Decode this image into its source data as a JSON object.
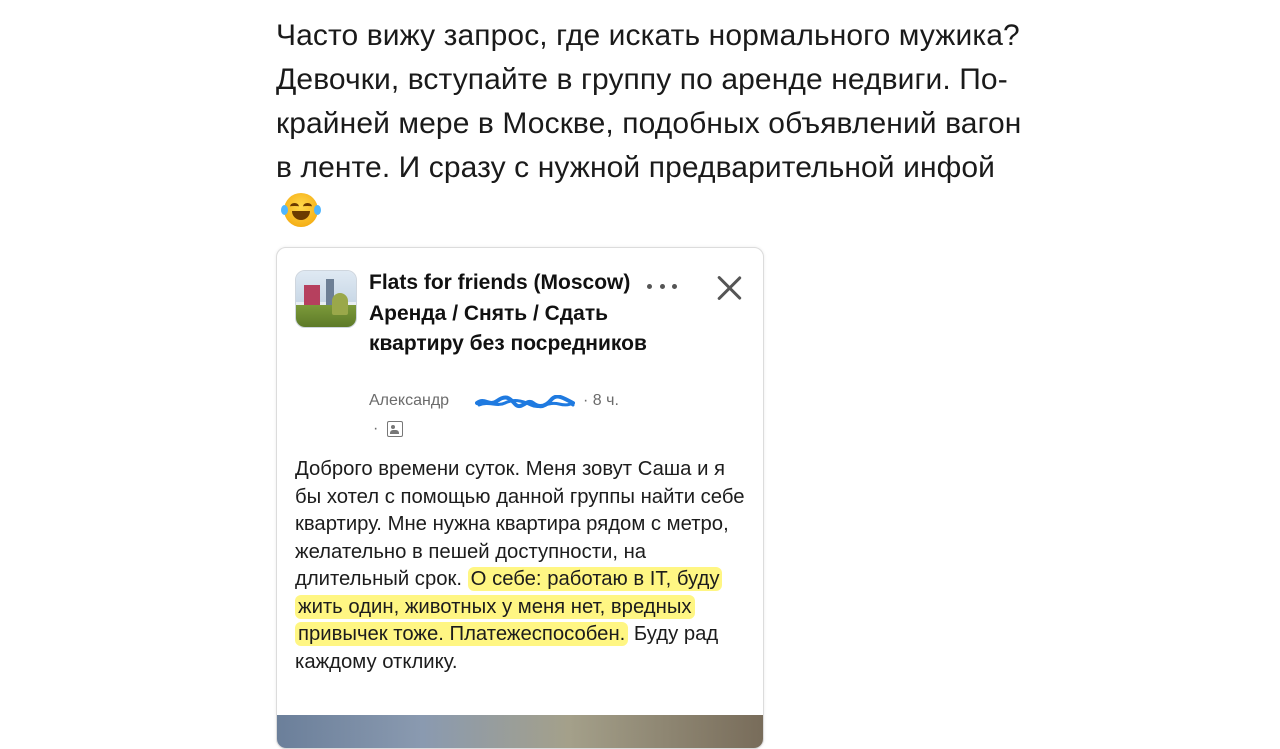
{
  "caption": {
    "text": "Часто вижу запрос, где искать нормального мужика? Девочки, вступайте в группу по аренде недвиги. По-крайней мере в Москве, подобных объявлений вагон в ленте. И сразу с нужной предварительной инфой",
    "emoji": "face-with-tears-of-joy-icon"
  },
  "post": {
    "group_title": "Flats for friends (Moscow) Аренда / Снять / Сдать квартиру без посредников",
    "author": "Александр",
    "time": "8 ч.",
    "separator": "·",
    "body_plain": "Доброго времени суток. Меня зовут Саша и я бы хотел с помощью данной группы найти себе квартиру. Мне нужна квартира рядом с метро, желательно в пешей доступности, на длительный срок. ",
    "body_highlight": "О себе: работаю в IT, буду жить один, животных у меня нет, вредных привычек тоже. Платежеспособен.",
    "body_after": " Буду рад каждому отклику."
  },
  "colors": {
    "highlight": "#fff35a",
    "scribble": "#1f7ae0"
  }
}
